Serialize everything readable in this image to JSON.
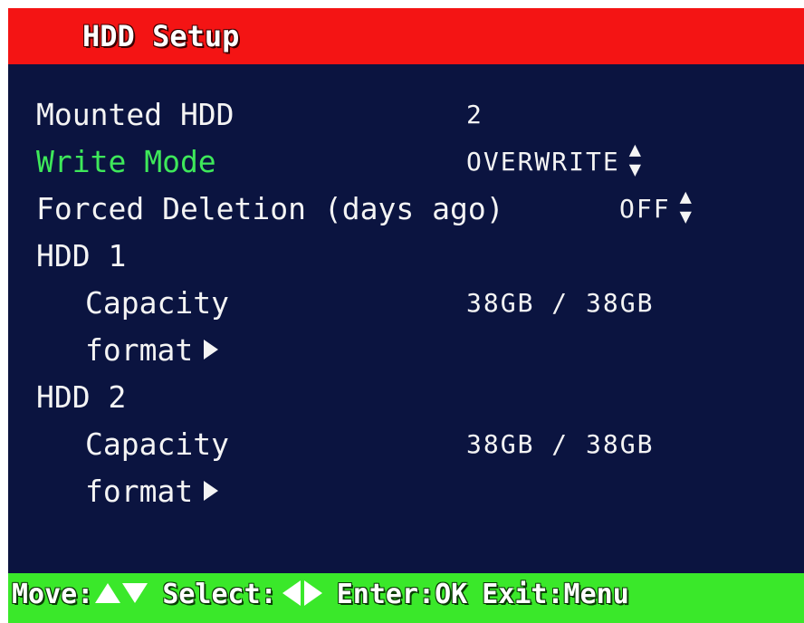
{
  "title": "HDD Setup",
  "colors": {
    "title_bar": "#f41414",
    "background": "#0b1440",
    "status_bar": "#3ae82a",
    "selected_text": "#3ee85a",
    "text": "#f4f4f4"
  },
  "menu": {
    "mounted_hdd": {
      "label": "Mounted HDD",
      "value": "2"
    },
    "write_mode": {
      "label": "Write Mode",
      "value": "OVERWRITE",
      "icon": "up-down-arrows-icon"
    },
    "forced_deletion": {
      "label": "Forced Deletion (days ago)",
      "value": "OFF",
      "icon": "up-down-arrows-icon"
    },
    "hdd1": {
      "label": "HDD 1",
      "capacity_label": "Capacity",
      "capacity_value": "38GB / 38GB",
      "format_label": "format"
    },
    "hdd2": {
      "label": "HDD 2",
      "capacity_label": "Capacity",
      "capacity_value": "38GB / 38GB",
      "format_label": "format"
    }
  },
  "status_bar": {
    "move_label": "Move:",
    "select_label": "Select:",
    "enter_label": "Enter:OK",
    "exit_label": "Exit:Menu"
  }
}
